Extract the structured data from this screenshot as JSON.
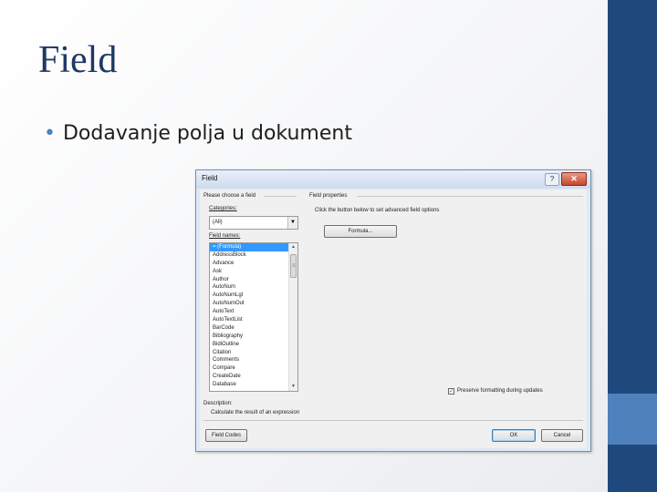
{
  "slide": {
    "title": "Field",
    "bullet_glyph": "•",
    "bullet_text": "Dodavanje polja u dokument"
  },
  "dialog": {
    "title": "Field",
    "help_glyph": "?",
    "close_glyph": "✕",
    "left_group_label": "Please choose a field",
    "categories_label": "Categories:",
    "category_value": "(All)",
    "field_names_label": "Field names:",
    "field_names": [
      "= (Formula)",
      "AddressBlock",
      "Advance",
      "Ask",
      "Author",
      "AutoNum",
      "AutoNumLgl",
      "AutoNumOut",
      "AutoText",
      "AutoTextList",
      "BarCode",
      "Bibliography",
      "BidiOutline",
      "Citation",
      "Comments",
      "Compare",
      "CreateDate",
      "Database"
    ],
    "selected_field_index": 0,
    "right_group_label": "Field properties",
    "properties_hint": "Click the button below to set advanced field options",
    "formula_button": "Formula...",
    "preserve_label": "Preserve formatting during updates",
    "preserve_checked": true,
    "check_glyph": "✓",
    "description_label": "Description:",
    "description_text": "Calculate the result of an expression",
    "field_codes_button": "Field Codes",
    "ok_button": "OK",
    "cancel_button": "Cancel",
    "dropdown_glyph": "▼",
    "scroll_up_glyph": "▲",
    "scroll_down_glyph": "▼",
    "scroll_grip_glyph": "≡"
  },
  "colors": {
    "title_color": "#1f3864",
    "bar_dark": "#1f497d",
    "bar_accent": "#4f81bd",
    "selection": "#3399ff"
  }
}
